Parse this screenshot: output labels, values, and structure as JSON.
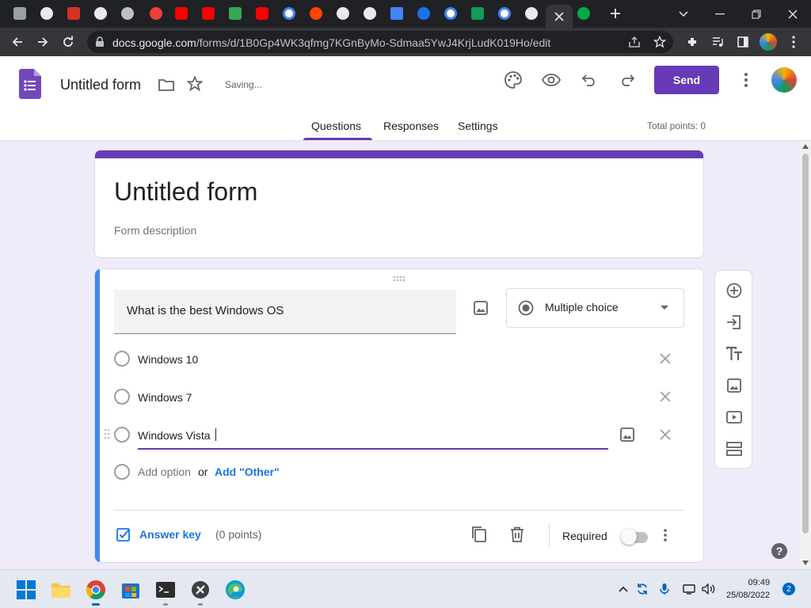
{
  "browser": {
    "url_host": "docs.google.com",
    "url_path": "/forms/d/1B0Gp4WK3qfmg7KGnByMo-Sdmaa5YwJ4KrjLudK019Ho/edit"
  },
  "header": {
    "doc_title": "Untitled form",
    "status": "Saving...",
    "send_label": "Send",
    "tabs": [
      "Questions",
      "Responses",
      "Settings"
    ],
    "total_points": "Total points: 0"
  },
  "form": {
    "title": "Untitled form",
    "description_placeholder": "Form description"
  },
  "question": {
    "text": "What is the best Windows OS",
    "type": "Multiple choice",
    "options": [
      "Windows 10",
      "Windows 7",
      "Windows Vista"
    ],
    "add_option": "Add option",
    "or_label": "or",
    "add_other": "Add \"Other\"",
    "answer_key": "Answer key",
    "points": "(0 points)",
    "required_label": "Required",
    "required": false
  },
  "taskbar": {
    "time": "09:49",
    "date": "25/08/2022",
    "notifications": "2"
  },
  "colors": {
    "accent": "#673ab7",
    "link": "#1a73e8",
    "focus_bar": "#4285f4"
  }
}
